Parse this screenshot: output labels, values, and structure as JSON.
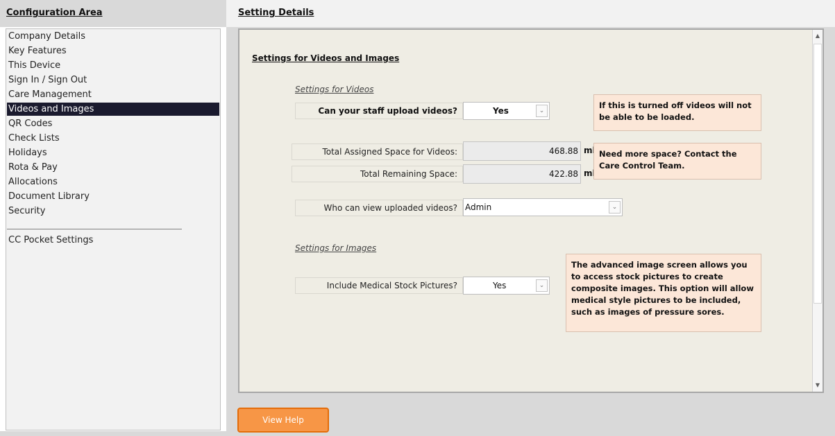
{
  "left": {
    "title": "Configuration Area",
    "items": [
      {
        "label": "Company Details"
      },
      {
        "label": "Key Features"
      },
      {
        "label": "This Device"
      },
      {
        "label": "Sign In / Sign Out"
      },
      {
        "label": "Care Management"
      },
      {
        "label": "Videos and Images",
        "selected": true
      },
      {
        "label": "QR Codes"
      },
      {
        "label": "Check Lists"
      },
      {
        "label": "Holidays"
      },
      {
        "label": "Rota & Pay"
      },
      {
        "label": "Allocations"
      },
      {
        "label": "Document Library"
      },
      {
        "label": "Security"
      }
    ],
    "extra_item": "CC Pocket Settings"
  },
  "right": {
    "title": "Setting Details",
    "section_heading": "Settings for Videos and Images",
    "videos": {
      "subheading": "Settings for Videos",
      "upload_label": "Can your staff upload videos?",
      "upload_value": "Yes",
      "upload_note": "If this is turned off videos will not be able to be loaded.",
      "assigned_label": "Total Assigned Space for Videos:",
      "assigned_value": "468.88",
      "remaining_label": "Total Remaining Space:",
      "remaining_value": "422.88",
      "unit": "mb",
      "space_note": "Need more space?  Contact the Care Control Team.",
      "viewers_label": "Who can view uploaded videos?",
      "viewers_value": "Admin"
    },
    "images": {
      "subheading": "Settings for Images",
      "stock_label": "Include Medical Stock Pictures?",
      "stock_value": "Yes",
      "stock_note": "The advanced image screen allows you to access stock pictures to create composite images.  This option will allow medical style pictures to be included, such as images of pressure sores."
    }
  },
  "footer": {
    "help_label": "View Help"
  },
  "icons": {
    "dropdown": "chevron-down-icon",
    "scroll_up": "triangle-up-icon",
    "scroll_down": "triangle-down-icon"
  }
}
